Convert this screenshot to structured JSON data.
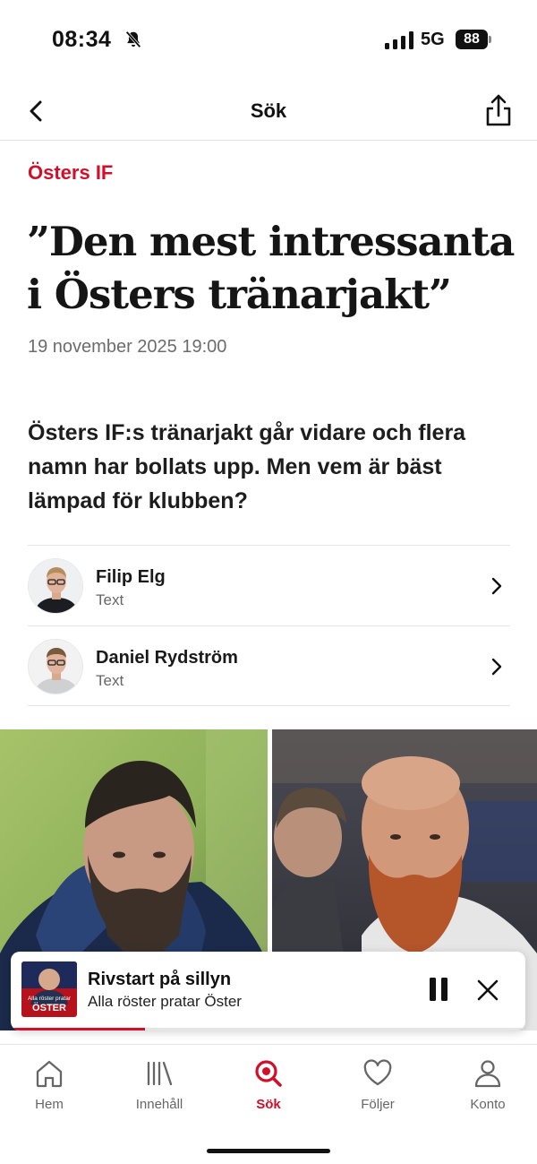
{
  "status_bar": {
    "time": "08:34",
    "network": "5G",
    "battery": "88"
  },
  "navbar": {
    "title": "Sök",
    "back_icon": "chevron-left-icon",
    "share_icon": "share-icon"
  },
  "article": {
    "kicker": "Östers IF",
    "headline": "”Den mest intressanta i Östers tränarjakt”",
    "date": "19 november 2025 19:00",
    "lead": "Östers IF:s tränarjakt går vidare och flera namn har bollats upp. Men vem är bäst lämpad för klubben?",
    "authors": [
      {
        "name": "Filip Elg",
        "role": "Text"
      },
      {
        "name": "Daniel Rydström",
        "role": "Text"
      }
    ]
  },
  "player": {
    "title": "Rivstart på sillyn",
    "subtitle": "Alla röster pratar Öster",
    "progress": 0.26,
    "artwork_text_top": "Alla röster pratar",
    "artwork_text_main": "ÖSTER"
  },
  "tabbar": {
    "items": [
      {
        "label": "Hem",
        "icon": "home-icon"
      },
      {
        "label": "Innehåll",
        "icon": "library-icon"
      },
      {
        "label": "Sök",
        "icon": "search-icon",
        "active": true
      },
      {
        "label": "Följer",
        "icon": "heart-icon"
      },
      {
        "label": "Konto",
        "icon": "person-icon"
      }
    ]
  },
  "colors": {
    "accent": "#d10f2a",
    "text": "#1a1a1a",
    "muted": "#6c6c6c"
  }
}
